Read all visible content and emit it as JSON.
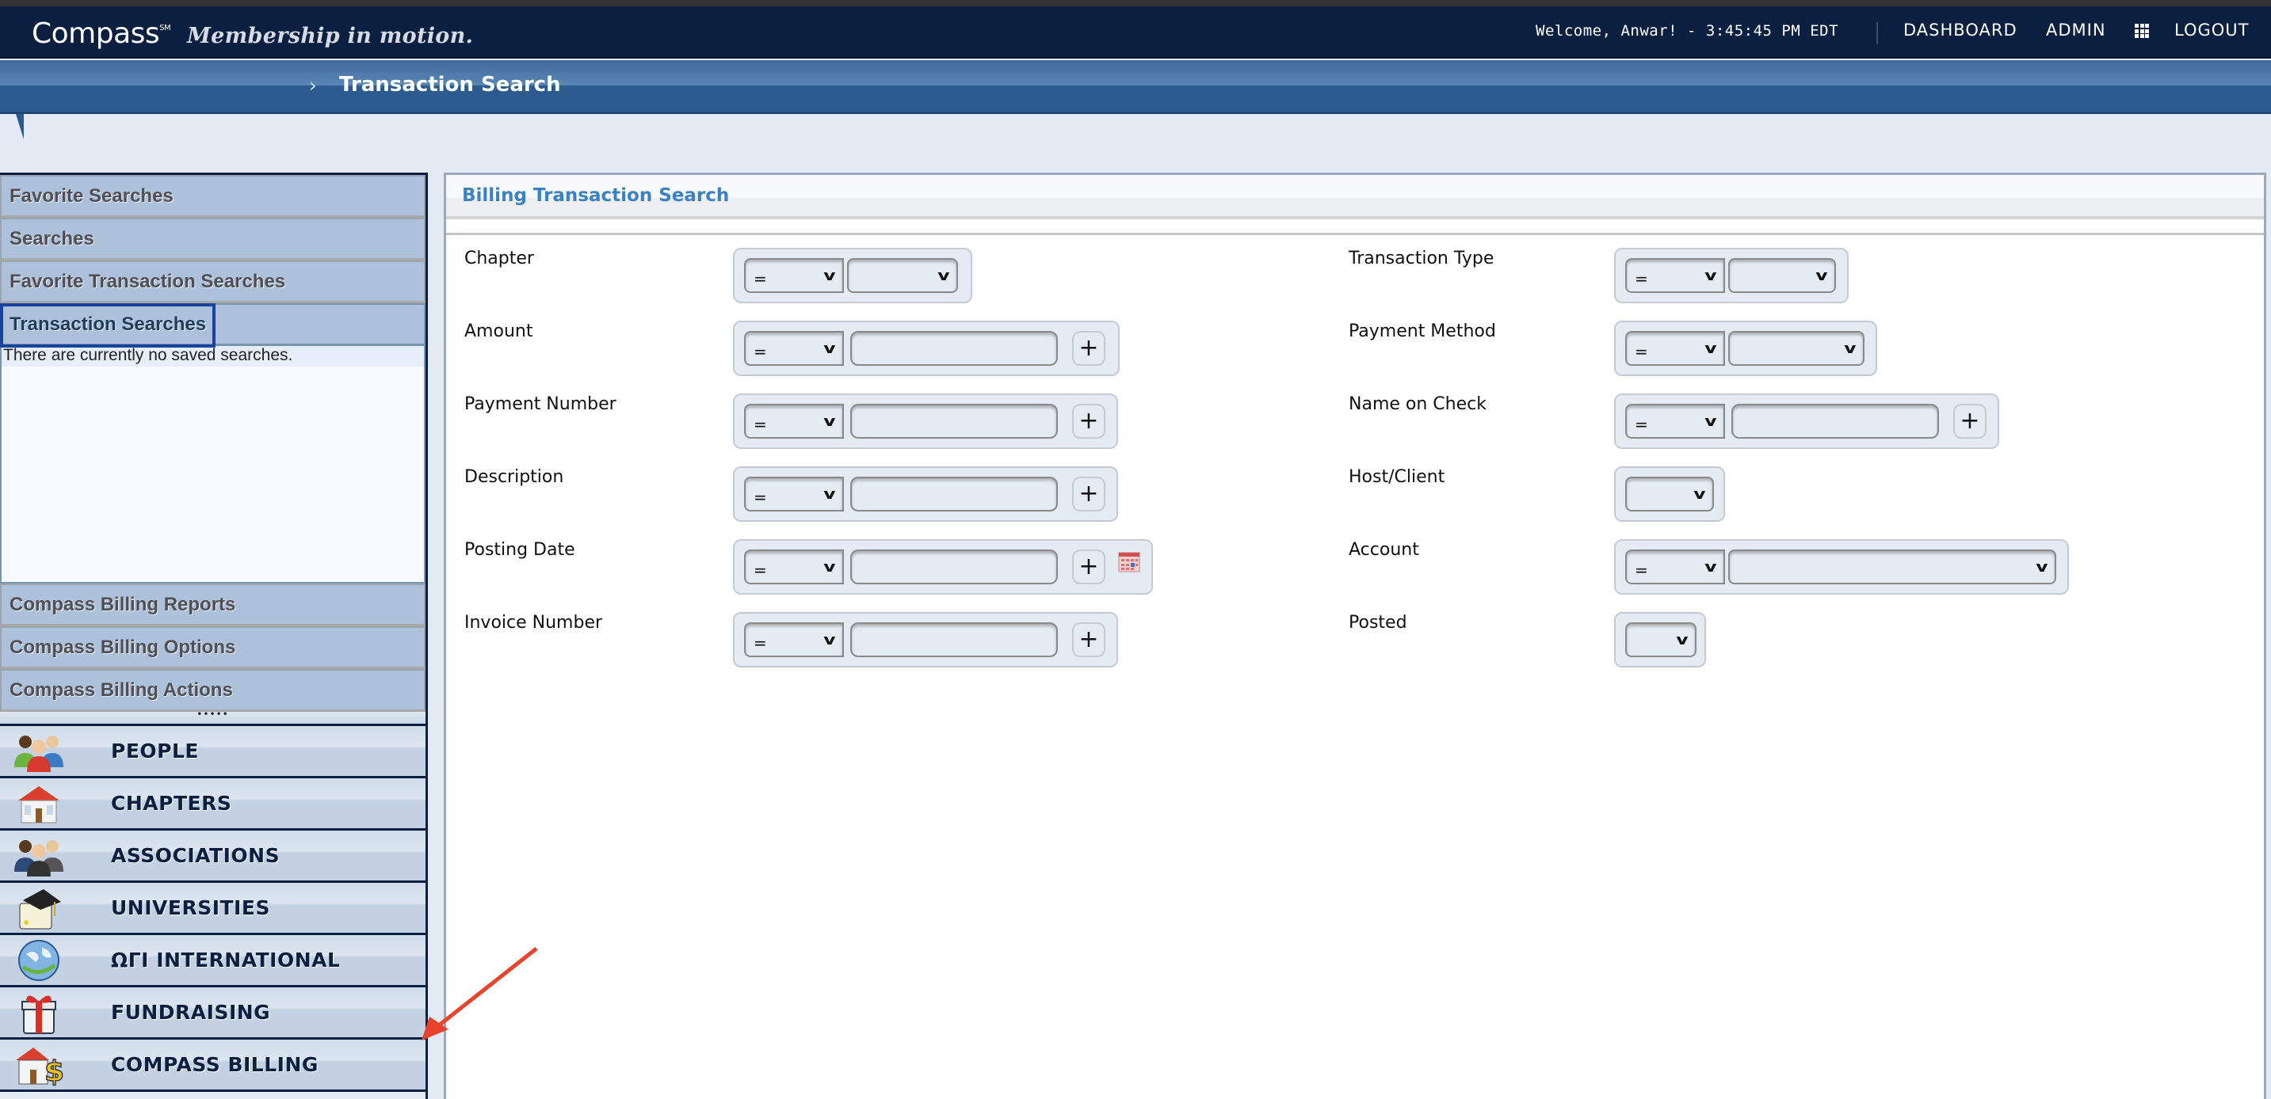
{
  "header": {
    "logo": "Compass",
    "logo_mark": "SM",
    "tagline": "Membership in motion.",
    "welcome": "Welcome, Anwar! - 3:45:45 PM EDT",
    "nav": {
      "dashboard": "DASHBOARD",
      "admin": "ADMIN",
      "apps_icon": "grid-icon",
      "logout": "LOGOUT"
    }
  },
  "breadcrumb": {
    "separator": "›",
    "title": "Transaction Search"
  },
  "sidebar": {
    "accordion": [
      {
        "label": "Favorite Searches"
      },
      {
        "label": "Searches"
      },
      {
        "label": "Favorite Transaction Searches"
      },
      {
        "label": "Transaction Searches",
        "active": true,
        "body": "There are currently no saved searches."
      },
      {
        "label": "Compass Billing Reports"
      },
      {
        "label": "Compass Billing Options"
      },
      {
        "label": "Compass Billing Actions"
      }
    ],
    "resizer": "•••••",
    "modules": [
      {
        "label": "PEOPLE",
        "icon": "people-icon"
      },
      {
        "label": "CHAPTERS",
        "icon": "chapter-house-icon"
      },
      {
        "label": "ASSOCIATIONS",
        "icon": "associations-icon"
      },
      {
        "label": "UNIVERSITIES",
        "icon": "graduation-cap-icon"
      },
      {
        "label": "ΩΓΙ INTERNATIONAL",
        "icon": "globe-icon"
      },
      {
        "label": "FUNDRAISING",
        "icon": "gift-icon"
      },
      {
        "label": "COMPASS BILLING",
        "icon": "billing-house-dollar-icon"
      }
    ]
  },
  "panel": {
    "title": "Billing Transaction Search",
    "left_fields": [
      {
        "label": "Chapter",
        "operator": "=",
        "value": "",
        "kind": "select"
      },
      {
        "label": "Amount",
        "operator": "=",
        "value": "",
        "kind": "text"
      },
      {
        "label": "Payment Number",
        "operator": "=",
        "value": "",
        "kind": "text"
      },
      {
        "label": "Description",
        "operator": "=",
        "value": "",
        "kind": "text"
      },
      {
        "label": "Posting Date",
        "operator": "=",
        "value": "",
        "kind": "date"
      },
      {
        "label": "Invoice Number",
        "operator": "=",
        "value": "",
        "kind": "text"
      }
    ],
    "right_fields": [
      {
        "label": "Transaction Type",
        "operator": "=",
        "value": "",
        "kind": "select"
      },
      {
        "label": "Payment Method",
        "operator": "=",
        "value": "",
        "kind": "select"
      },
      {
        "label": "Name on Check",
        "operator": "=",
        "value": "",
        "kind": "text"
      },
      {
        "label": "Host/Client",
        "value": "",
        "kind": "select-only"
      },
      {
        "label": "Account",
        "operator": "=",
        "value": "",
        "kind": "select-wide"
      },
      {
        "label": "Posted",
        "value": "",
        "kind": "select-only"
      }
    ],
    "add_button": "+",
    "caret": "v"
  },
  "colors": {
    "header_bg": "#0b1f40",
    "crumb_bg": "#2b5a8e",
    "accordion_bg": "#adc1da",
    "panel_title": "#3b82c4",
    "focus_ring": "#1a43a0",
    "annotation_arrow": "#e8432d"
  }
}
